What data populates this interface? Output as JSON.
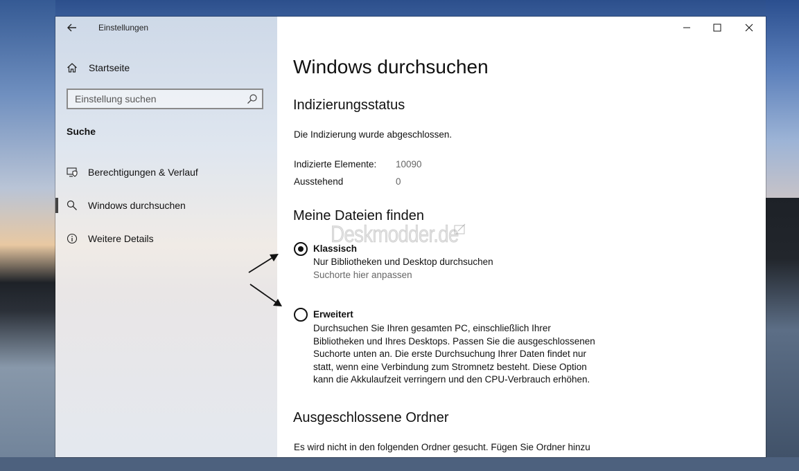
{
  "window": {
    "title": "Einstellungen"
  },
  "sidebar": {
    "home_label": "Startseite",
    "search_placeholder": "Einstellung suchen",
    "section_label": "Suche",
    "items": [
      {
        "label": "Berechtigungen & Verlauf",
        "icon": "permissions-history-icon"
      },
      {
        "label": "Windows durchsuchen",
        "icon": "search-icon",
        "active": true
      },
      {
        "label": "Weitere Details",
        "icon": "info-icon"
      }
    ]
  },
  "main": {
    "page_title": "Windows durchsuchen",
    "indexing": {
      "heading": "Indizierungsstatus",
      "status_text": "Die Indizierung wurde abgeschlossen.",
      "indexed_label": "Indizierte Elemente:",
      "indexed_value": "10090",
      "pending_label": "Ausstehend",
      "pending_value": "0"
    },
    "find_files": {
      "heading": "Meine Dateien finden",
      "options": [
        {
          "title": "Klassisch",
          "selected": true,
          "description_lines": [
            "Nur Bibliotheken und Desktop durchsuchen"
          ],
          "link": "Suchorte hier anpassen"
        },
        {
          "title": "Erweitert",
          "selected": false,
          "description_lines": [
            "Durchsuchen Sie Ihren gesamten PC, einschließlich Ihrer",
            "Bibliotheken und Ihres Desktops. Passen Sie die ausgeschlossenen",
            "Suchorte unten an. Die erste Durchsuchung Ihrer Daten findet nur",
            "statt, wenn eine Verbindung zum Stromnetz besteht. Diese Option",
            "kann die Akkulaufzeit verringern und den CPU-Verbrauch erhöhen."
          ]
        }
      ]
    },
    "excluded": {
      "heading": "Ausgeschlossene Ordner",
      "text": "Es wird nicht in den folgenden Ordner gesucht. Fügen Sie Ordner hinzu"
    },
    "watermark": "Deskmodder.de"
  },
  "colors": {
    "sidebar_bg": "#dfe6ef",
    "active_indicator": "#444444",
    "text": "#111111",
    "muted_text": "#666666"
  }
}
